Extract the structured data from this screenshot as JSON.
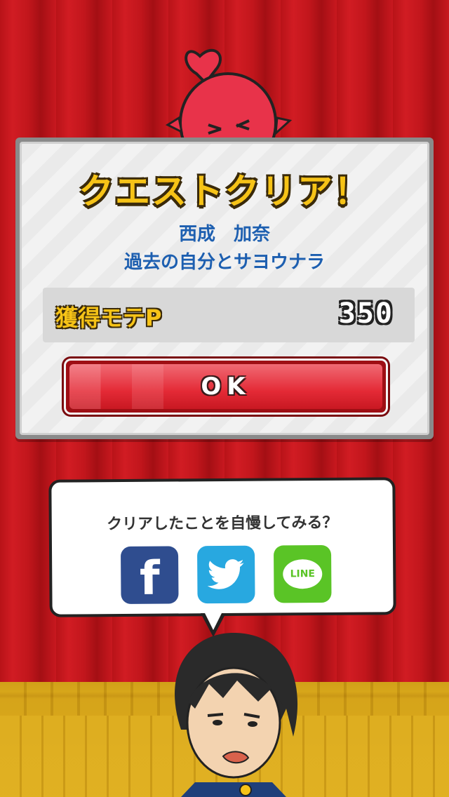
{
  "quest": {
    "title": "クエストクリア！",
    "character_name": "西成　加奈",
    "quest_name": "過去の自分とサヨウナラ"
  },
  "reward": {
    "label": "獲得モテP",
    "value": "350"
  },
  "ok_button": {
    "label": "OK"
  },
  "share": {
    "prompt": "クリアしたことを自慢してみる？",
    "buttons": [
      {
        "service": "Facebook",
        "icon": "facebook-icon",
        "color": "#2f4d8f"
      },
      {
        "service": "Twitter",
        "icon": "twitter-icon",
        "color": "#28a8e0"
      },
      {
        "service": "LINE",
        "icon": "line-icon",
        "color": "#5ac426",
        "text": "LINE"
      }
    ]
  },
  "colors": {
    "curtain": "#c8161d",
    "title_yellow": "#f6c317",
    "subtitle_blue": "#1d5fb0",
    "ok_red": "#e42a36"
  }
}
